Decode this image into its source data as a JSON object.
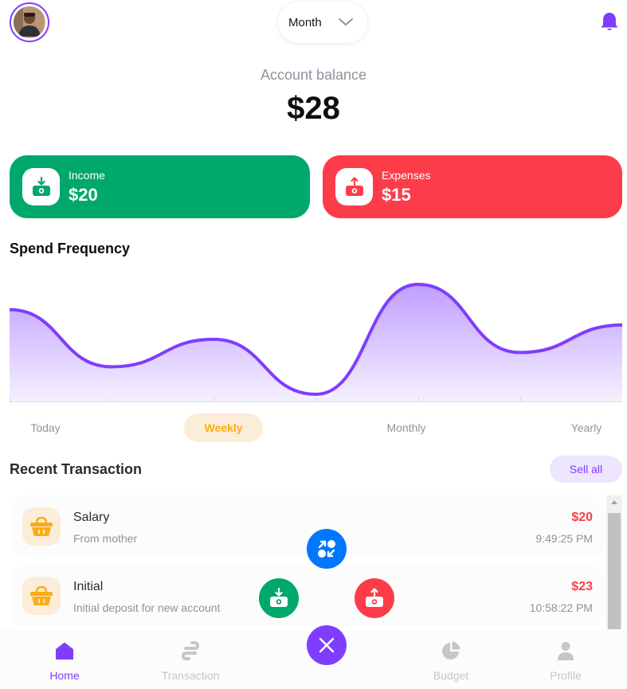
{
  "header": {
    "month_label": "Month",
    "avatar_icon": "user-avatar",
    "notification_icon": "bell-icon",
    "accent": "#7f3dff"
  },
  "balance": {
    "label": "Account balance",
    "value": "$28"
  },
  "cards": {
    "income": {
      "title": "Income",
      "value": "$20",
      "color": "#00a86b",
      "icon": "income-icon"
    },
    "expenses": {
      "title": "Expenses",
      "value": "$15",
      "color": "#fd3c4a",
      "icon": "expense-icon"
    }
  },
  "spend_frequency": {
    "title": "Spend Frequency",
    "line_color": "#7f3dff"
  },
  "chart_data": {
    "type": "area",
    "title": "Spend Frequency",
    "xlabel": "",
    "ylabel": "",
    "x": [
      0,
      1,
      2,
      3,
      4,
      5,
      6
    ],
    "series": [
      {
        "values": [
          0.77,
          0.25,
          0.5,
          0.0,
          1.0,
          0.38,
          0.63
        ]
      }
    ],
    "grid": false,
    "legend": "none"
  },
  "period_tabs": [
    {
      "label": "Today",
      "active": false
    },
    {
      "label": "Weekly",
      "active": true
    },
    {
      "label": "Monthly",
      "active": false
    },
    {
      "label": "Yearly",
      "active": false
    }
  ],
  "recent": {
    "title": "Recent Transaction",
    "see_all_label": "Sell all",
    "transactions": [
      {
        "title": "Salary",
        "description": "From mother",
        "amount": "$20",
        "time": "9:49:25 PM",
        "icon": "shopping-basket-icon"
      },
      {
        "title": "Initial",
        "description": "Initial deposit for new account",
        "amount": "$23",
        "time": "10:58:22 PM",
        "icon": "shopping-basket-icon"
      }
    ]
  },
  "fab": {
    "transfer_icon": "transfer-icon",
    "income_icon": "income-icon",
    "expense_icon": "expense-icon",
    "close_icon": "close-icon"
  },
  "nav": [
    {
      "label": "Home",
      "icon": "home-icon",
      "active": true
    },
    {
      "label": "Transaction",
      "icon": "transaction-icon",
      "active": false
    },
    {
      "label": "Budget",
      "icon": "pie-chart-icon",
      "active": false
    },
    {
      "label": "Profile",
      "icon": "user-icon",
      "active": false
    }
  ]
}
